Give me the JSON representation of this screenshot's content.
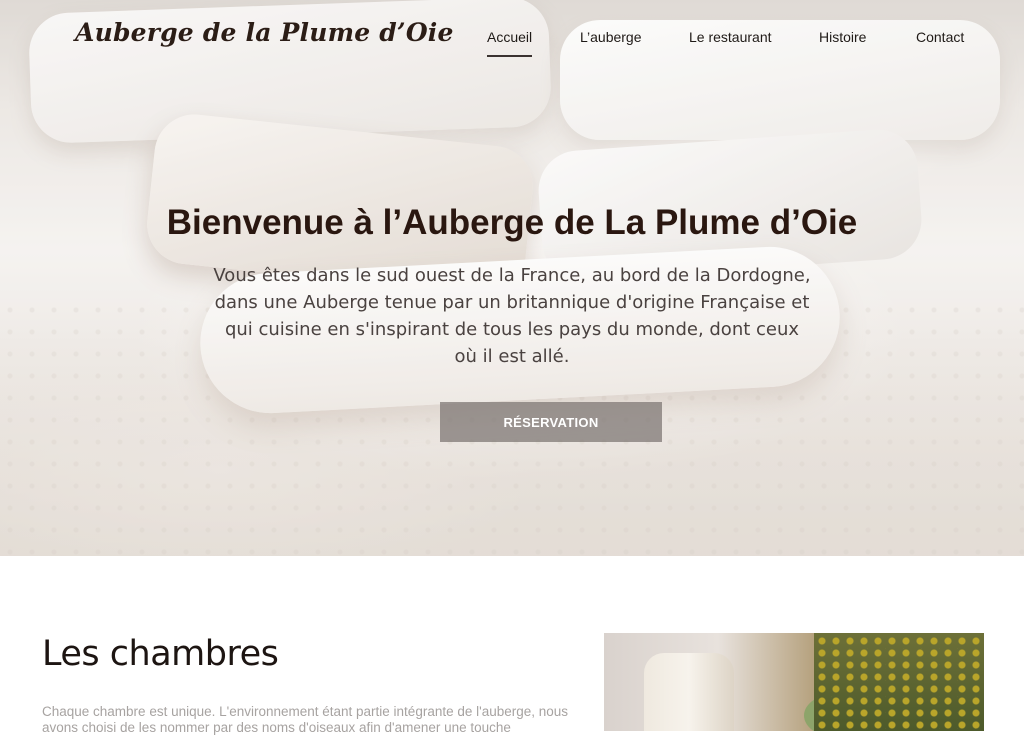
{
  "header": {
    "logo_text": "Auberge de la Plume d’Oie",
    "nav": [
      {
        "label": "Accueil",
        "active": true
      },
      {
        "label": "L’auberge",
        "active": false
      },
      {
        "label": "Le restaurant",
        "active": false
      },
      {
        "label": "Histoire",
        "active": false
      },
      {
        "label": "Contact",
        "active": false
      }
    ]
  },
  "hero": {
    "title": "Bienvenue à l’Auberge de La Plume d’Oie",
    "text": "Vous êtes dans le sud ouest de la France, au bord de la Dordogne, dans une Auberge tenue par un britannique d'origine Française et qui cuisine en s'inspirant de tous les pays du monde, dont ceux où il est allé.",
    "button_label": "RÉSERVATION"
  },
  "rooms": {
    "title": "Les chambres",
    "text": "Chaque chambre est unique.  L'environnement étant partie intégrante de l'auberge, nous avons choisi de les nommer par des noms d'oiseaux afin d'amener une touche"
  },
  "colors": {
    "title": "#2a1710",
    "button_bg": "#78706e",
    "body_text": "#a7a3a1"
  }
}
